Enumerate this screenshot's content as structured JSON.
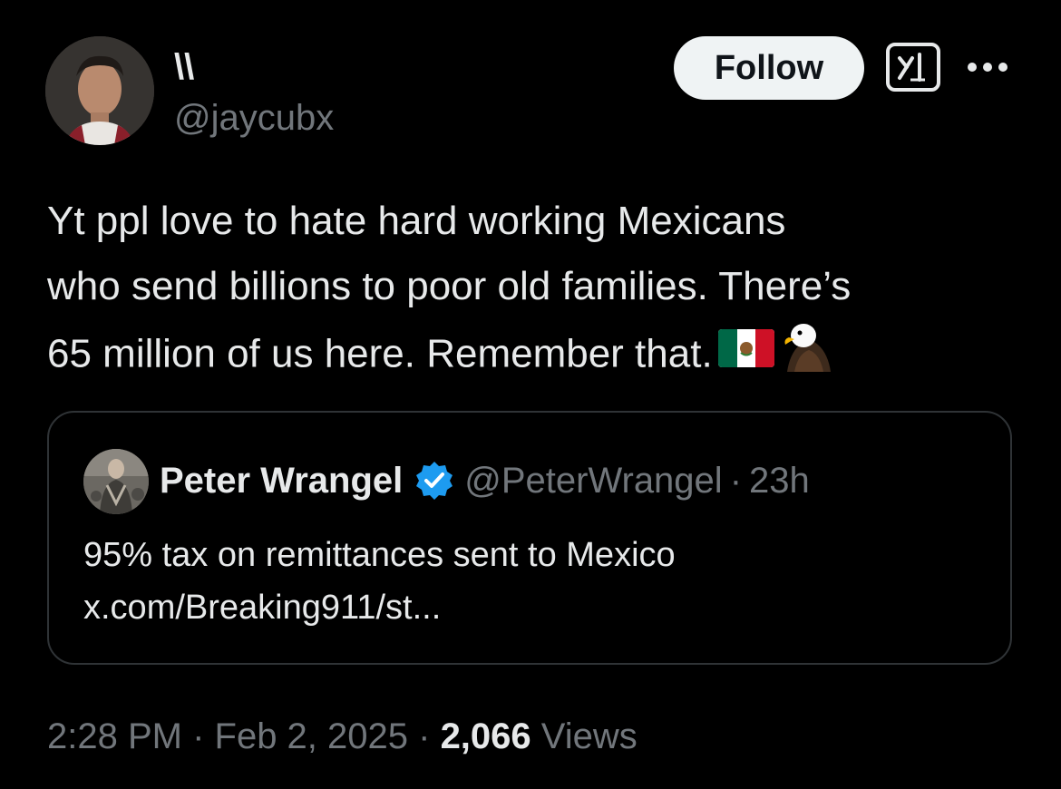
{
  "author": {
    "display_name": "\\\\",
    "handle": "@jaycubx",
    "avatar_icon": "profile-photo"
  },
  "actions": {
    "follow_label": "Follow",
    "grok_icon": "grok-icon",
    "more_icon": "more-dots-icon"
  },
  "tweet": {
    "line1": "Yt ppl love to hate hard working Mexicans",
    "line2": "who send billions to poor old families. There’s",
    "line3": "65 million of us here. Remember that.",
    "emojis": [
      "mexico-flag",
      "eagle"
    ]
  },
  "quote": {
    "name": "Peter Wrangel",
    "verified": true,
    "handle": "@PeterWrangel",
    "separator": "·",
    "time": "23h",
    "text_line1": "95% tax on remittances sent to Mexico",
    "text_line2": "x.com/Breaking911/st..."
  },
  "meta": {
    "time": "2:28 PM",
    "sep1": " · ",
    "date": "Feb 2, 2025",
    "sep2": " · ",
    "views_count": "2,066",
    "views_label": " Views"
  },
  "colors": {
    "background": "#000000",
    "text": "#e7e9ea",
    "muted": "#71767b",
    "verified": "#1d9bf0",
    "border": "#2f3336"
  }
}
